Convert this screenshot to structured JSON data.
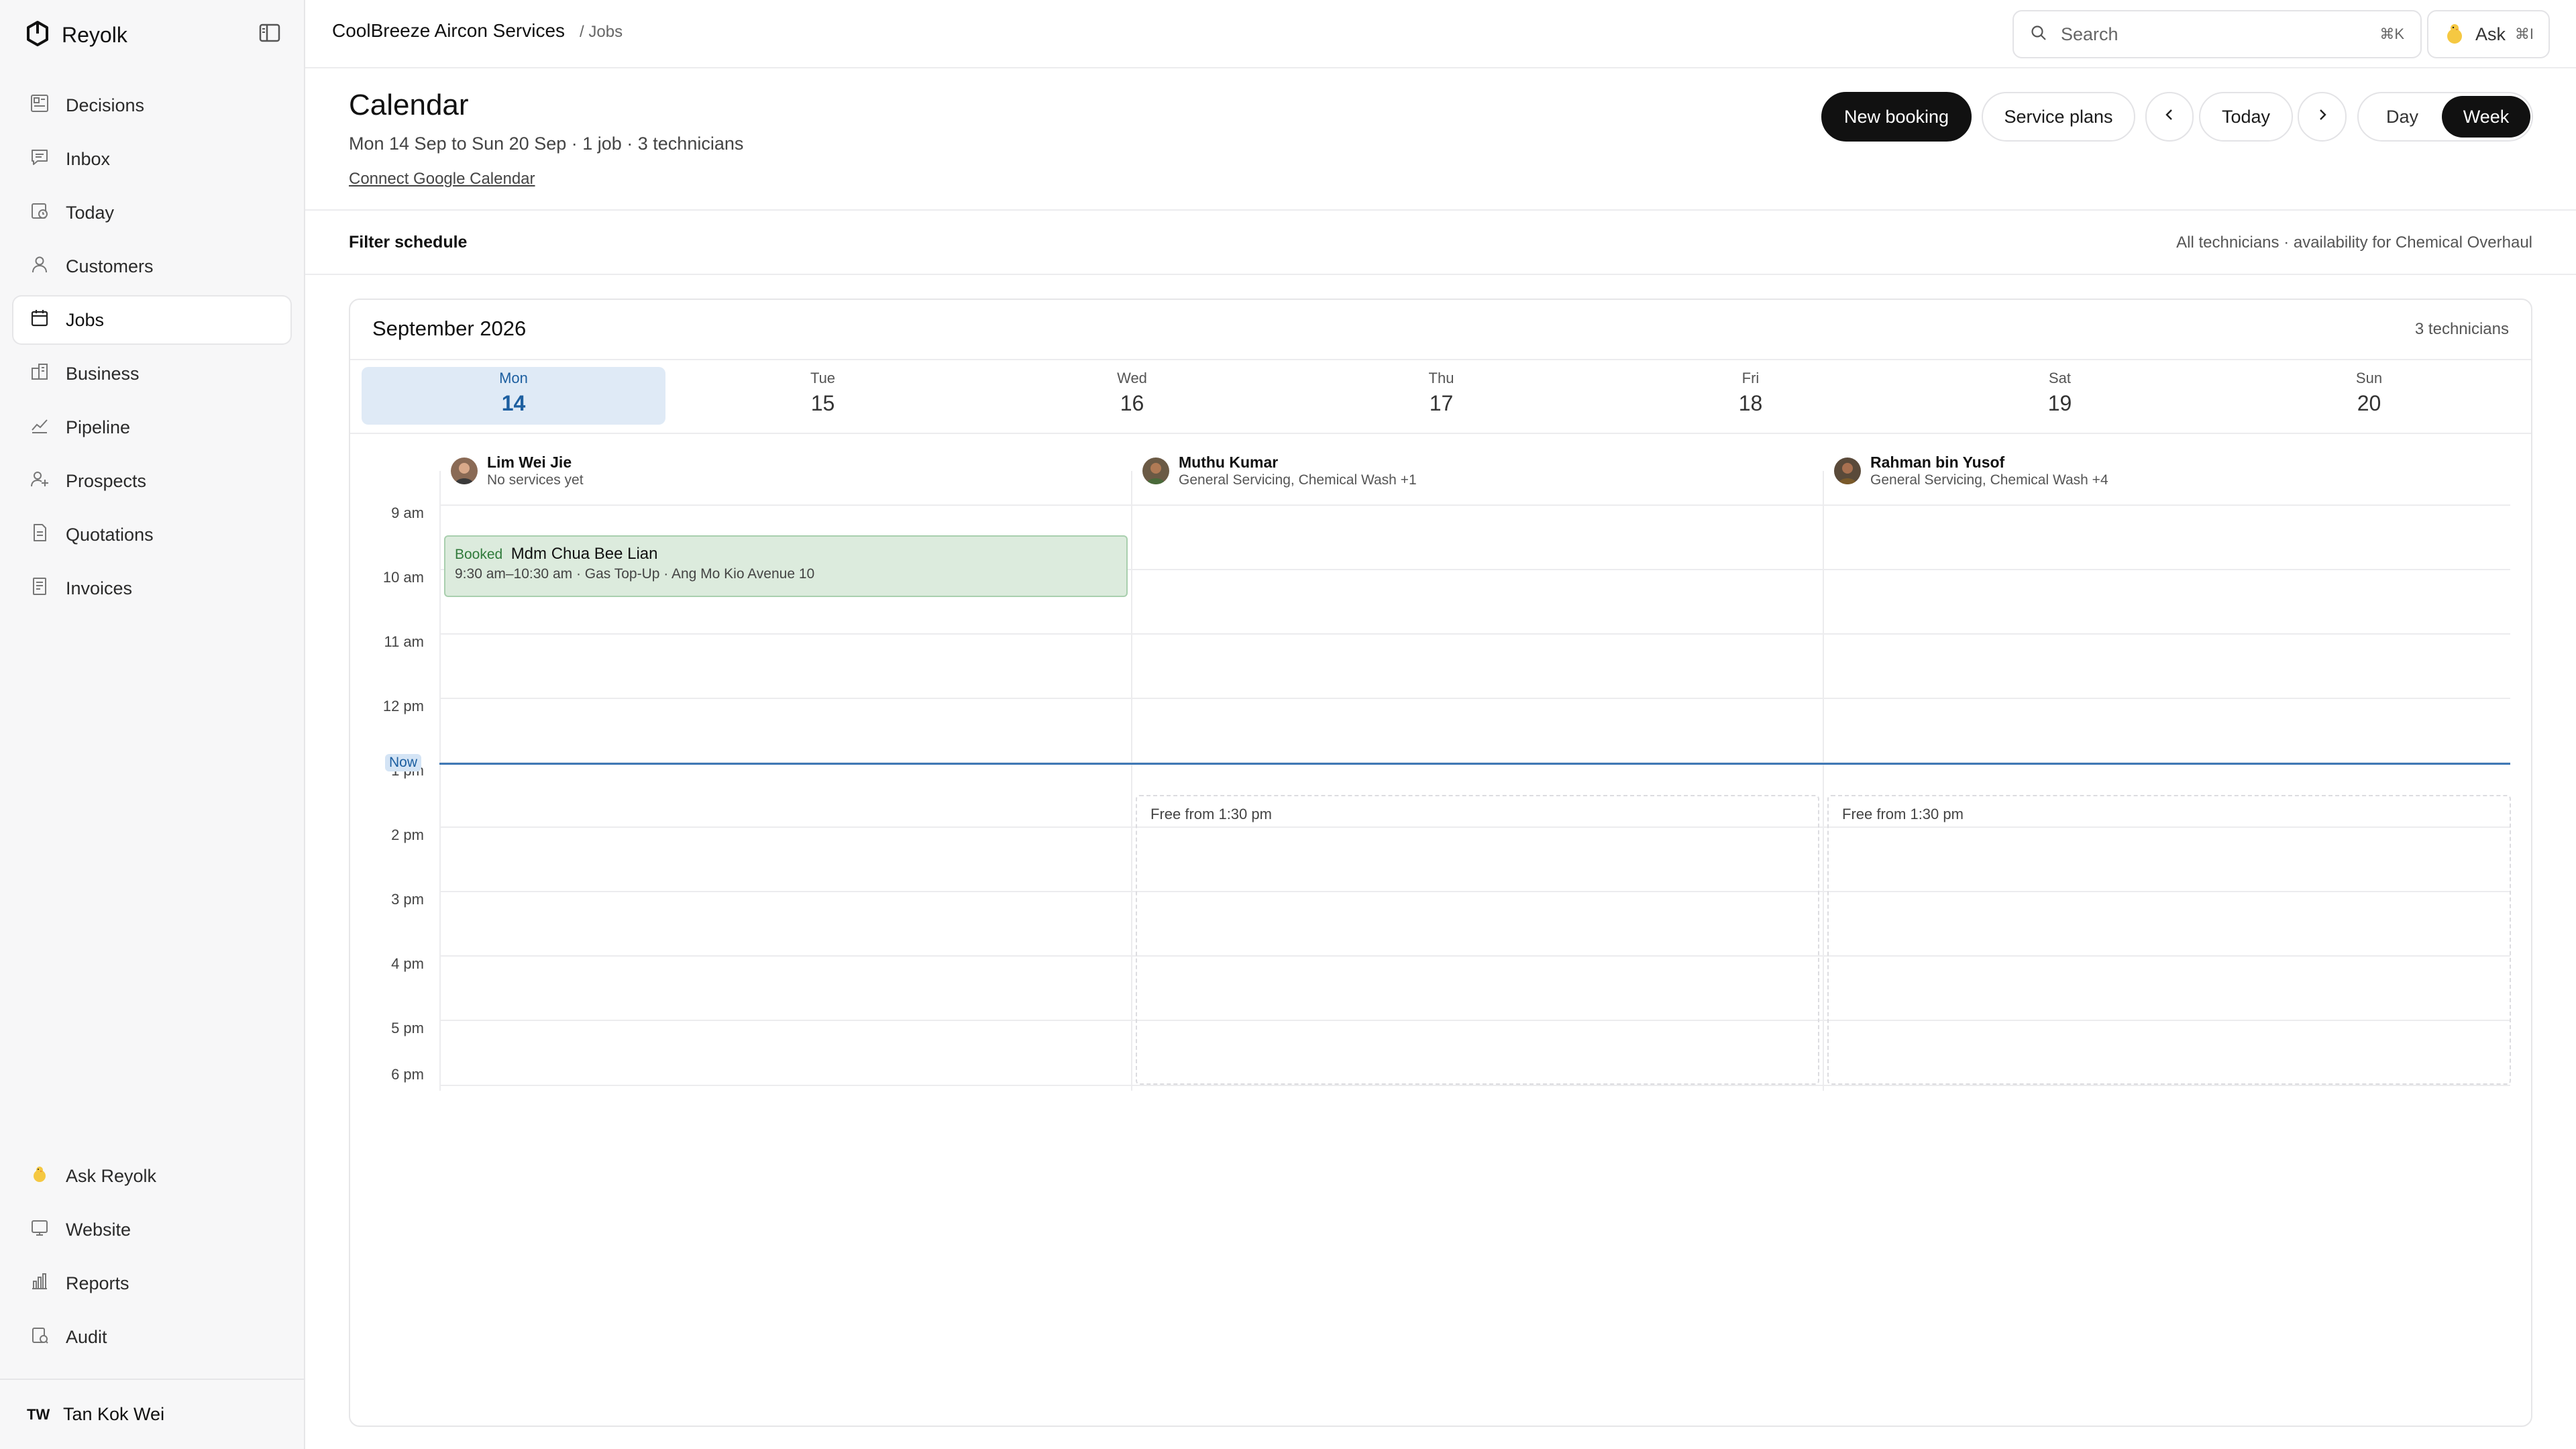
{
  "app": {
    "name": "Reyolk"
  },
  "sidebar": {
    "nav": [
      {
        "label": "Decisions",
        "icon": "decisions-icon"
      },
      {
        "label": "Inbox",
        "icon": "inbox-icon"
      },
      {
        "label": "Today",
        "icon": "today-icon"
      },
      {
        "label": "Customers",
        "icon": "customers-icon"
      },
      {
        "label": "Jobs",
        "icon": "calendar-icon",
        "active": true
      },
      {
        "label": "Business",
        "icon": "business-icon"
      },
      {
        "label": "Pipeline",
        "icon": "pipeline-icon"
      },
      {
        "label": "Prospects",
        "icon": "prospects-icon"
      },
      {
        "label": "Quotations",
        "icon": "quotation-icon"
      },
      {
        "label": "Invoices",
        "icon": "invoice-icon"
      }
    ],
    "bottom": [
      {
        "label": "Ask Reyolk",
        "icon": "chick-icon"
      },
      {
        "label": "Website",
        "icon": "website-icon"
      },
      {
        "label": "Reports",
        "icon": "reports-icon"
      },
      {
        "label": "Audit",
        "icon": "audit-icon"
      }
    ],
    "user": {
      "initials": "TW",
      "name": "Tan Kok Wei"
    }
  },
  "topbar": {
    "company": "CoolBreeze Aircon Services",
    "section": "/ Jobs",
    "search_placeholder": "Search",
    "search_shortcut": "⌘K",
    "ask_label": "Ask",
    "ask_shortcut": "⌘I"
  },
  "header": {
    "title": "Calendar",
    "subtitle": "Mon 14 Sep to Sun 20 Sep · 1 job · 3 technicians",
    "connect_link": "Connect Google Calendar",
    "new_booking": "New booking",
    "service_plans": "Service plans",
    "today": "Today",
    "view_day": "Day",
    "view_week": "Week",
    "active_view": "Week"
  },
  "filter": {
    "title": "Filter schedule",
    "summary": "All technicians · availability for Chemical Overhaul"
  },
  "calendar": {
    "month": "September 2026",
    "tech_count": "3 technicians",
    "days": [
      {
        "name": "Mon",
        "num": "14",
        "selected": true
      },
      {
        "name": "Tue",
        "num": "15"
      },
      {
        "name": "Wed",
        "num": "16"
      },
      {
        "name": "Thu",
        "num": "17"
      },
      {
        "name": "Fri",
        "num": "18"
      },
      {
        "name": "Sat",
        "num": "19"
      },
      {
        "name": "Sun",
        "num": "20"
      }
    ],
    "technicians": [
      {
        "name": "Lim Wei Jie",
        "services": "No services yet"
      },
      {
        "name": "Muthu Kumar",
        "services": "General Servicing, Chemical Wash +1"
      },
      {
        "name": "Rahman bin Yusof",
        "services": "General Servicing, Chemical Wash +4"
      }
    ],
    "hours": [
      "9 am",
      "10 am",
      "11 am",
      "12 pm",
      "1 pm",
      "2 pm",
      "3 pm",
      "4 pm",
      "5 pm",
      "6 pm"
    ],
    "now_label": "Now",
    "event": {
      "status": "Booked",
      "customer": "Mdm Chua Bee Lian",
      "detail": "9:30 am–10:30 am · Gas Top-Up · Ang Mo Kio Avenue 10"
    },
    "free_label": "Free from 1:30 pm",
    "colors": {
      "accent": "#3f78b5",
      "booked_bg": "#dcebdd",
      "booked_text": "#2f7a3a",
      "selected_day": "#dfeaf6"
    }
  }
}
